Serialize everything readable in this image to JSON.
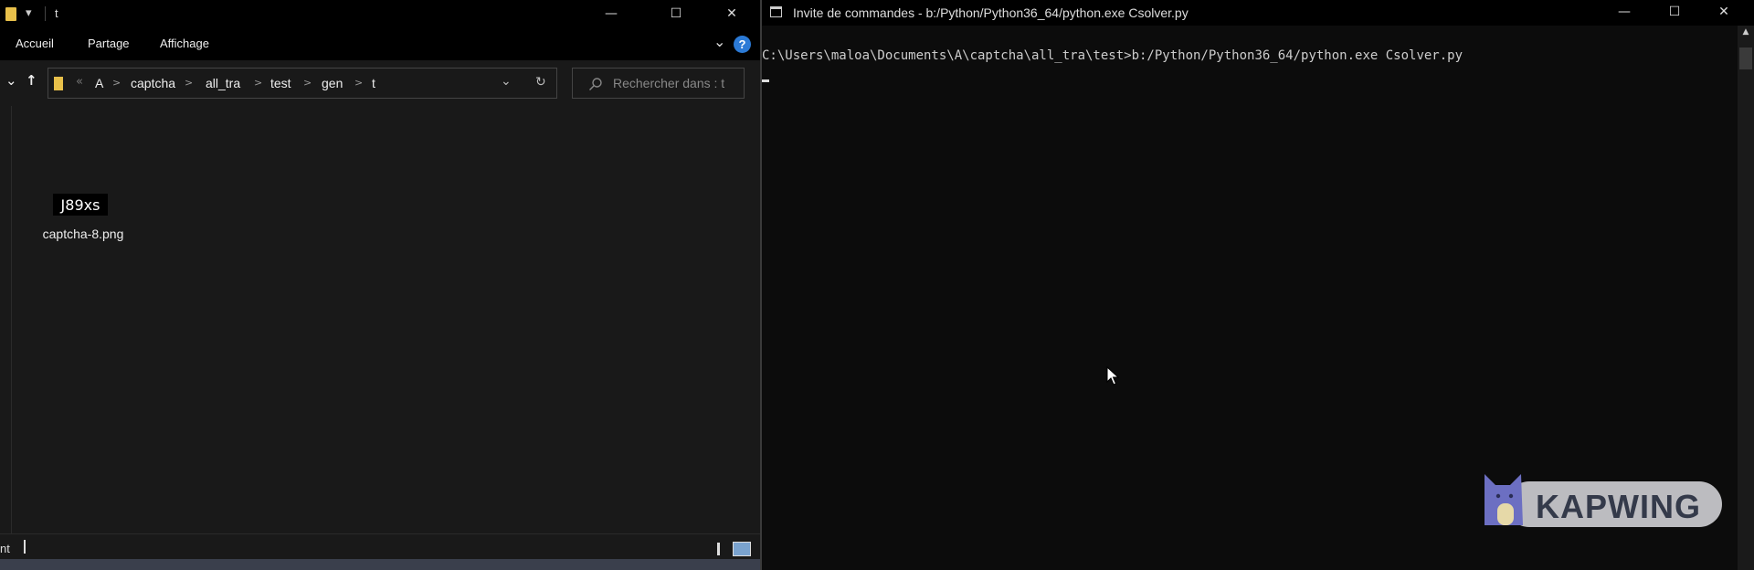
{
  "explorer": {
    "title": "t",
    "quick_access_glyph": "▾",
    "window_buttons": {
      "minimize": "—",
      "maximize": "☐",
      "close": "✕"
    },
    "ribbon_tabs": [
      "Accueil",
      "Partage",
      "Affichage"
    ],
    "ribbon_collapse_glyph": "⌄",
    "help_label": "?",
    "nav": {
      "recent_glyph": "⌄",
      "up_glyph": "↑",
      "history_glyph": "«",
      "dropdown_glyph": "⌄",
      "refresh_glyph": "↻"
    },
    "breadcrumb": [
      "A",
      "captcha",
      "all_tra",
      "test",
      "gen",
      "t"
    ],
    "breadcrumb_sep": ">",
    "search": {
      "placeholder": "Rechercher dans : t"
    },
    "file": {
      "thumbnail_text": "J89xs",
      "name": "captcha-8.png"
    },
    "status_text": "nt"
  },
  "cmd": {
    "title": "Invite de commandes - b:/Python/Python36_64/python.exe  Csolver.py",
    "window_buttons": {
      "minimize": "—",
      "maximize": "☐",
      "close": "✕"
    },
    "line": "C:\\Users\\maloa\\Documents\\A\\captcha\\all_tra\\test>b:/Python/Python36_64/python.exe Csolver.py",
    "scroll_up_glyph": "▲"
  },
  "watermark": {
    "text": "KAPWING"
  },
  "colors": {
    "explorer_bg": "#191919",
    "titlebar_bg": "#000000",
    "console_bg": "#0c0c0c",
    "folder_yellow": "#e8c04a",
    "help_blue": "#2b7ad6"
  },
  "icons": [
    "folder-icon",
    "help-icon",
    "up-arrow-icon",
    "refresh-icon",
    "search-icon",
    "console-icon",
    "mouse-pointer-icon",
    "kapwing-logo-icon"
  ]
}
